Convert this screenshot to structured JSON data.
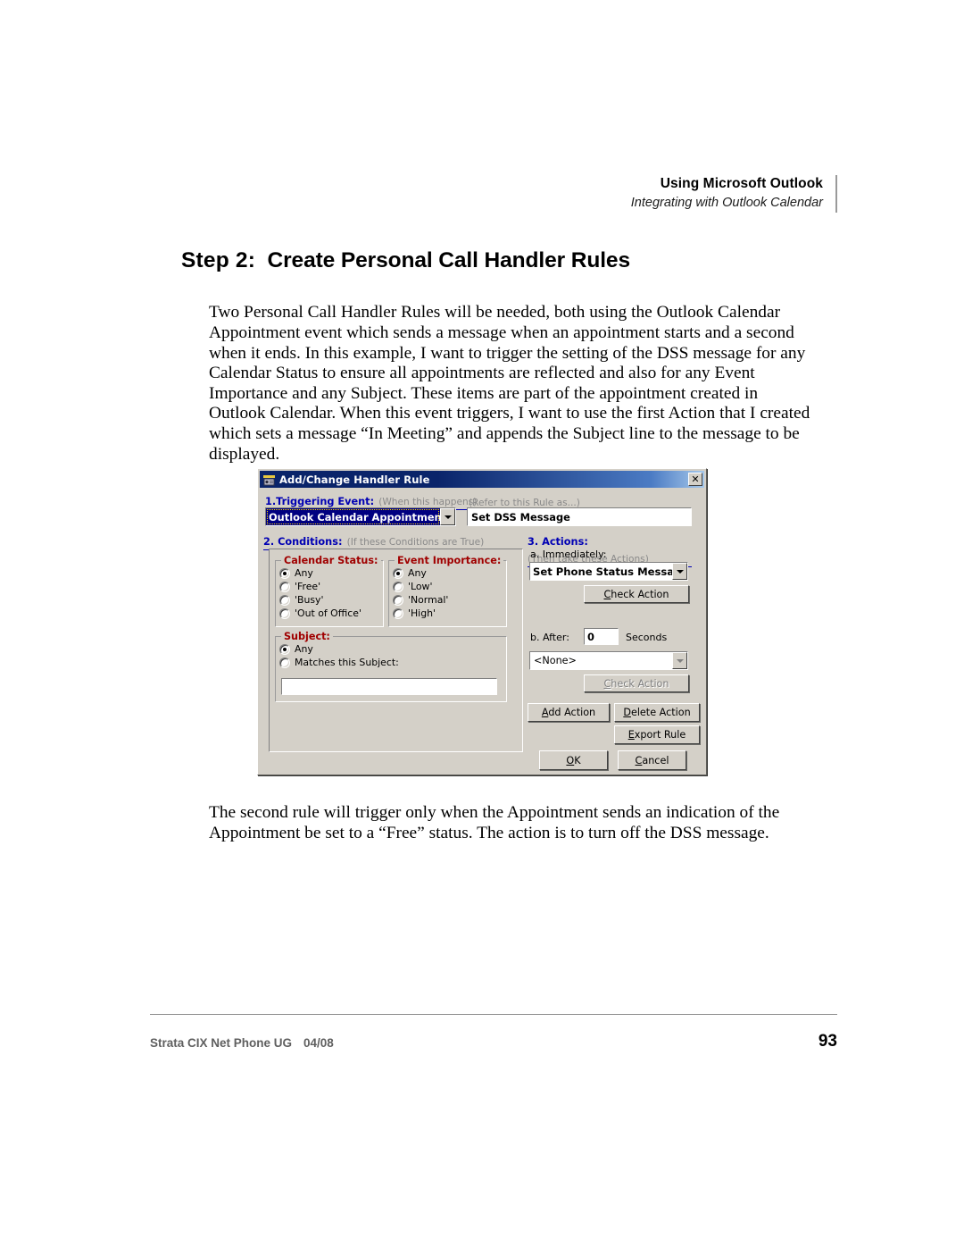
{
  "header": {
    "title": "Using Microsoft Outlook",
    "subtitle": "Integrating with Outlook Calendar"
  },
  "section": {
    "step_label": "Step 2:",
    "title": "Create Personal Call Handler Rules"
  },
  "paragraphs": {
    "intro": "Two Personal Call Handler Rules will be needed, both using the Outlook Calendar Appointment event which sends a message when an appointment starts and a second when it ends.  In this example, I want to trigger the setting of the DSS message for any Calendar Status to ensure all appointments are reflected and also for any Event Importance and any Subject.  These items are part of the appointment created in Outlook Calendar.  When this event triggers, I want to use the first Action that I created which sets a message “In Meeting” and appends the Subject line to the message to be displayed.",
    "closing": "The second rule will trigger only when the Appointment sends an indication of the Appointment be set to a “Free” status.  The action is to turn off the DSS message."
  },
  "dialog": {
    "title": "Add/Change Handler Rule",
    "close_label": "✕",
    "icon": "phone-app-icon",
    "triggering_event": {
      "label": "1.Triggering Event:",
      "note": "(When this happens)",
      "selected": "Outlook Calendar Appointment"
    },
    "rule_name": {
      "note": "(Refer to this Rule as...)",
      "value": "Set DSS Message"
    },
    "conditions": {
      "label": "2. Conditions:",
      "note": "(If these Conditions are True)",
      "calendar_status": {
        "legend": "Calendar Status:",
        "options": [
          {
            "label": "Any",
            "selected": true
          },
          {
            "label": "'Free'",
            "selected": false
          },
          {
            "label": "'Busy'",
            "selected": false
          },
          {
            "label": "'Out of Office'",
            "selected": false
          }
        ]
      },
      "event_importance": {
        "legend": "Event Importance:",
        "options": [
          {
            "label": "Any",
            "selected": true
          },
          {
            "label": "'Low'",
            "selected": false
          },
          {
            "label": "'Normal'",
            "selected": false
          },
          {
            "label": "'High'",
            "selected": false
          }
        ]
      },
      "subject": {
        "legend": "Subject:",
        "options": [
          {
            "label": "Any",
            "selected": true
          },
          {
            "label": "Matches this Subject:",
            "selected": false
          }
        ],
        "input_value": ""
      }
    },
    "actions": {
      "label": "3. Actions:",
      "note": "(Then take these Actions)",
      "immediately_label": "a. Immediately:",
      "immediately_value": "Set Phone Status Message",
      "check_action_1": "Check Action",
      "after_label": "b. After:",
      "after_value": "0",
      "seconds_label": "Seconds",
      "after_action_value": "<None>",
      "check_action_2": "Check Action",
      "add_action": "Add Action",
      "delete_action": "Delete Action",
      "export_rule": "Export Rule",
      "ok": "OK",
      "cancel": "Cancel"
    }
  },
  "footer": {
    "doc_name": "Strata CIX Net Phone UG",
    "date": "04/08",
    "page_number": "93"
  },
  "colors": {
    "blue_heading": "#0000b4",
    "red_legend": "#a00000",
    "gray_note": "#8a8a8a",
    "titlebar": "#0a246a",
    "dialog_face": "#d4d0c8"
  }
}
